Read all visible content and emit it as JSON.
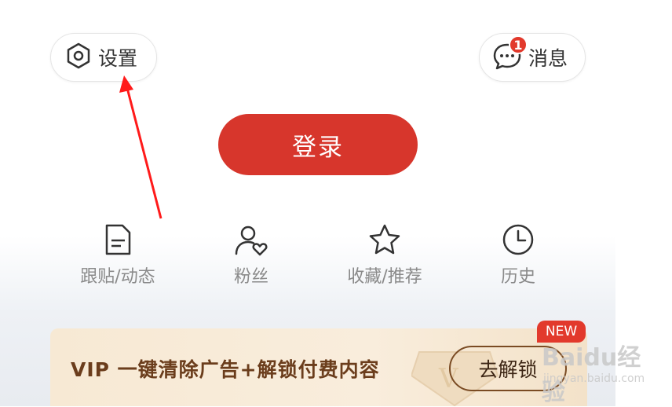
{
  "header": {
    "settings_label": "设置",
    "settings_icon": "hexagon-gear-icon",
    "messages_label": "消息",
    "messages_icon": "chat-bubble-icon",
    "message_badge": "1"
  },
  "login": {
    "label": "登录"
  },
  "functions": [
    {
      "label": "跟贴/动态",
      "icon": "document-icon"
    },
    {
      "label": "粉丝",
      "icon": "user-heart-icon"
    },
    {
      "label": "收藏/推荐",
      "icon": "star-icon"
    },
    {
      "label": "历史",
      "icon": "clock-icon"
    }
  ],
  "vip": {
    "text": "VIP 一键清除广告+解锁付费内容",
    "button_label": "去解锁",
    "new_tag": "NEW"
  },
  "watermark": {
    "brand": "Baidu经验",
    "site": "jingyan.baidu.com"
  },
  "colors": {
    "primary_red": "#d7362c",
    "badge_red": "#e2392c",
    "vip_text": "#6b3d1c",
    "annotation_arrow": "#ff1a1a"
  }
}
